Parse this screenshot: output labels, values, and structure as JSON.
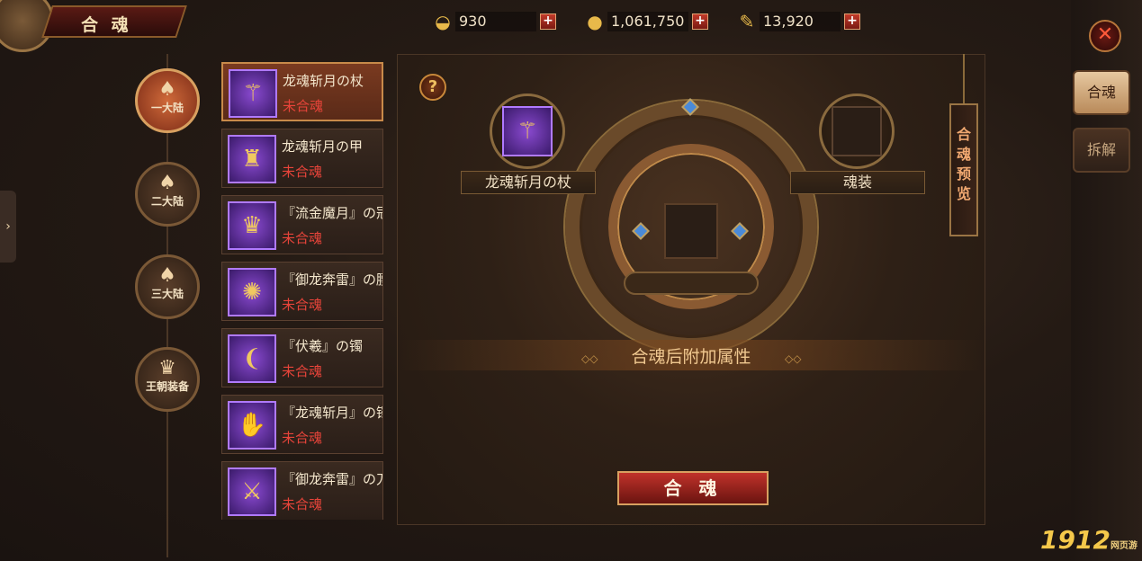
{
  "header": {
    "title": "合 魂"
  },
  "resources": [
    {
      "icon": "gold-ingot-icon",
      "value": "930",
      "plus": "+"
    },
    {
      "icon": "gold-coins-icon",
      "value": "1,061,750",
      "plus": "+"
    },
    {
      "icon": "scroll-icon",
      "value": "13,920",
      "plus": "+"
    }
  ],
  "close": {
    "symbol": "✕"
  },
  "side_tabs": [
    {
      "label": "合魂"
    },
    {
      "label": "拆解"
    }
  ],
  "left_handle": {
    "symbol": "›"
  },
  "categories": [
    {
      "label": "一大陆"
    },
    {
      "label": "二大陆"
    },
    {
      "label": "三大陆"
    },
    {
      "label": "王朝装备"
    }
  ],
  "items": [
    {
      "name": "龙魂斩月の杖",
      "status": "未合魂"
    },
    {
      "name": "龙魂斩月の甲",
      "status": "未合魂"
    },
    {
      "name": "『流金魔月』の冠",
      "status": "未合魂"
    },
    {
      "name": "『御龙奔雷』の腰",
      "status": "未合魂"
    },
    {
      "name": "『伏羲』の镯",
      "status": "未合魂"
    },
    {
      "name": "『龙魂斩月』の镯",
      "status": "未合魂"
    },
    {
      "name": "『御龙奔雷』の刀",
      "status": "未合魂"
    }
  ],
  "main": {
    "help": "?",
    "left_slot_label": "龙魂斩月の杖",
    "right_slot_label": "魂装",
    "preview": "合魂预览",
    "attr_title": "合魂后附加属性",
    "merge_button": "合 魂"
  },
  "logo": {
    "text": "1912",
    "sub": "网页游戏"
  }
}
